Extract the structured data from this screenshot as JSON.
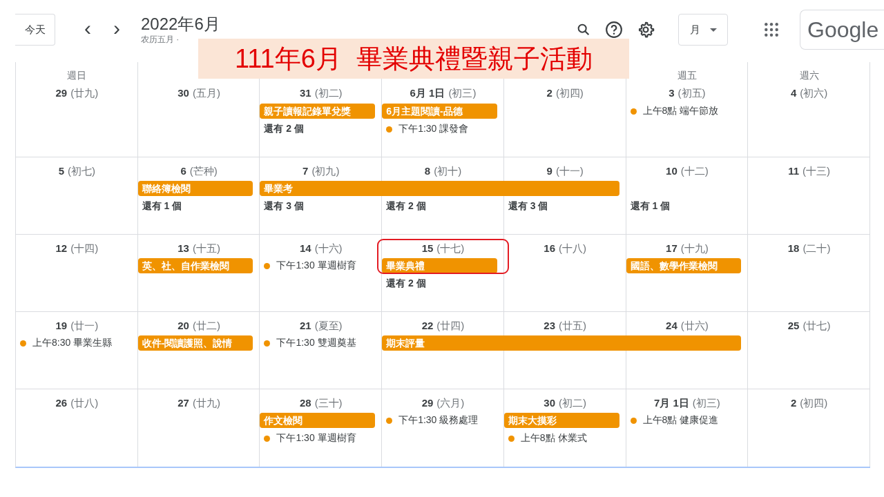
{
  "toolbar": {
    "today_button": "今天",
    "prev": "‹",
    "next": "›",
    "title": "2022年6月",
    "subtitle": "农历五月 ·",
    "view_select": "月",
    "logo": "Google"
  },
  "banner": {
    "text": "111年6月  畢業典禮暨親子活動"
  },
  "weeks": [
    {
      "days": [
        {
          "weekday": "週日",
          "date": "29",
          "lunar": "(廿九)"
        },
        {
          "date": "30",
          "lunar": "(五月)"
        },
        {
          "date": "31",
          "lunar": "(初二)",
          "events": [
            {
              "kind": "bar",
              "text": "親子讀報記錄單兌獎"
            },
            {
              "kind": "more",
              "text": "還有 2 個"
            }
          ]
        },
        {
          "date": "6月 1日",
          "lunar": "(初三)",
          "events": [
            {
              "kind": "bar",
              "text": "6月主題閱讀-品德"
            },
            {
              "kind": "dot",
              "text": "下午1:30 課發會"
            }
          ]
        },
        {
          "date": "2",
          "lunar": "(初四)"
        },
        {
          "weekday": "週五",
          "date": "3",
          "lunar": "(初五)",
          "events": [
            {
              "kind": "dot",
              "text": "上午8點 端午節放"
            }
          ]
        },
        {
          "weekday": "週六",
          "date": "4",
          "lunar": "(初六)"
        }
      ]
    },
    {
      "days": [
        {
          "date": "5",
          "lunar": "(初七)"
        },
        {
          "date": "6",
          "lunar": "(芒种)",
          "events": [
            {
              "kind": "bar",
              "text": "聯絡簿檢閱"
            },
            {
              "kind": "more",
              "text": "還有 1 個"
            }
          ]
        },
        {
          "date": "7",
          "lunar": "(初九)",
          "events": [
            {
              "kind": "bar",
              "text": "畢業考"
            },
            {
              "kind": "more",
              "text": "還有 3 個"
            }
          ]
        },
        {
          "date": "8",
          "lunar": "(初十)",
          "events": [
            {
              "kind": "continued"
            },
            {
              "kind": "more",
              "text": "還有 2 個"
            }
          ]
        },
        {
          "date": "9",
          "lunar": "(十一)",
          "events": [
            {
              "kind": "continued"
            },
            {
              "kind": "more",
              "text": "還有 3 個"
            }
          ]
        },
        {
          "date": "10",
          "lunar": "(十二)",
          "events": [
            {
              "kind": "empty"
            },
            {
              "kind": "more",
              "text": "還有 1 個"
            }
          ]
        },
        {
          "date": "11",
          "lunar": "(十三)"
        }
      ]
    },
    {
      "days": [
        {
          "date": "12",
          "lunar": "(十四)"
        },
        {
          "date": "13",
          "lunar": "(十五)",
          "events": [
            {
              "kind": "bar",
              "text": "英、社、自作業檢閱"
            }
          ]
        },
        {
          "date": "14",
          "lunar": "(十六)",
          "events": [
            {
              "kind": "dot",
              "text": "下午1:30 單週樹育"
            }
          ]
        },
        {
          "date": "15",
          "lunar": "(十七)",
          "circled": true,
          "events": [
            {
              "kind": "bar",
              "text": "畢業典禮"
            },
            {
              "kind": "more",
              "text": "還有 2 個"
            }
          ]
        },
        {
          "date": "16",
          "lunar": "(十八)"
        },
        {
          "date": "17",
          "lunar": "(十九)",
          "events": [
            {
              "kind": "bar",
              "text": "國語、數學作業檢閱"
            }
          ]
        },
        {
          "date": "18",
          "lunar": "(二十)"
        }
      ]
    },
    {
      "days": [
        {
          "date": "19",
          "lunar": "(廿一)",
          "events": [
            {
              "kind": "dot",
              "text": "上午8:30 畢業生縣"
            }
          ]
        },
        {
          "date": "20",
          "lunar": "(廿二)",
          "events": [
            {
              "kind": "bar",
              "text": "收件-閱讀護照、說情"
            }
          ]
        },
        {
          "date": "21",
          "lunar": "(夏至)",
          "events": [
            {
              "kind": "dot",
              "text": "下午1:30 雙週奠基"
            }
          ]
        },
        {
          "date": "22",
          "lunar": "(廿四)",
          "events": [
            {
              "kind": "bar",
              "text": "期末評量"
            }
          ]
        },
        {
          "date": "23",
          "lunar": "(廿五)",
          "events": [
            {
              "kind": "continued"
            }
          ]
        },
        {
          "date": "24",
          "lunar": "(廿六)",
          "events": [
            {
              "kind": "continued"
            }
          ]
        },
        {
          "date": "25",
          "lunar": "(廿七)"
        }
      ]
    },
    {
      "days": [
        {
          "date": "26",
          "lunar": "(廿八)"
        },
        {
          "date": "27",
          "lunar": "(廿九)"
        },
        {
          "date": "28",
          "lunar": "(三十)",
          "events": [
            {
              "kind": "bar",
              "text": "作文檢閱"
            },
            {
              "kind": "dot",
              "text": "下午1:30 單週樹育"
            }
          ]
        },
        {
          "date": "29",
          "lunar": "(六月)",
          "events": [
            {
              "kind": "dot",
              "text": "下午1:30 級務處理"
            }
          ]
        },
        {
          "date": "30",
          "lunar": "(初二)",
          "events": [
            {
              "kind": "bar",
              "text": "期末大摸彩"
            },
            {
              "kind": "dot",
              "text": "上午8點 休業式"
            }
          ]
        },
        {
          "date": "7月 1日",
          "lunar": "(初三)",
          "events": [
            {
              "kind": "dot",
              "text": "上午8點 健康促進"
            }
          ]
        },
        {
          "date": "2",
          "lunar": "(初四)"
        }
      ]
    }
  ]
}
